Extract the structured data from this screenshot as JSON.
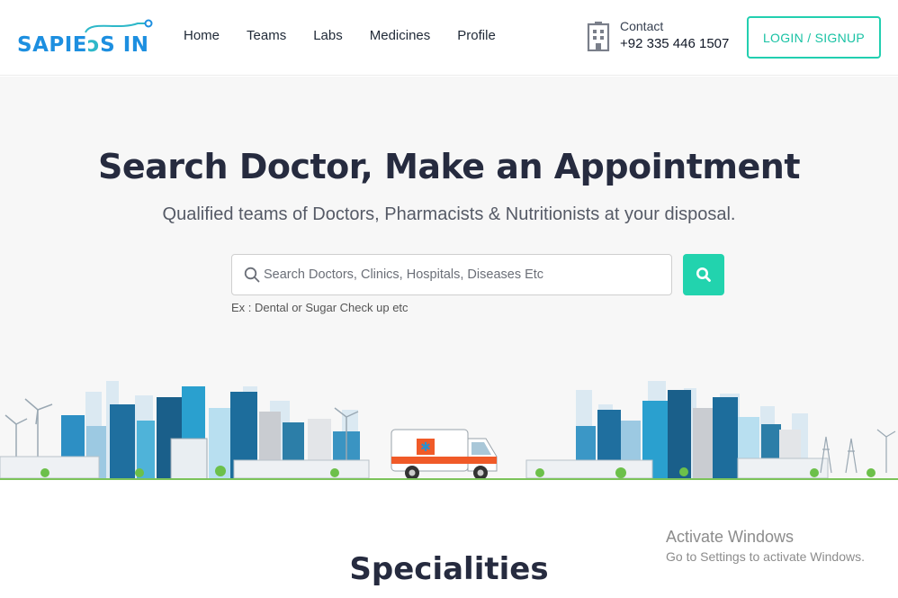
{
  "header": {
    "logo_text_a": "SAPIE",
    "logo_text_b": "S IN",
    "nav": [
      {
        "label": "Home"
      },
      {
        "label": "Teams"
      },
      {
        "label": "Labs"
      },
      {
        "label": "Medicines"
      },
      {
        "label": "Profile"
      }
    ],
    "contact_label": "Contact",
    "contact_phone": "+92 335 446 1507",
    "contact_icon": "building-icon",
    "login_label": "LOGIN / SIGNUP"
  },
  "hero": {
    "title": "Search Doctor, Make an Appointment",
    "subtitle": "Qualified teams of Doctors, Pharmacists & Nutritionists at your disposal.",
    "search_placeholder": "Search Doctors, Clinics, Hospitals, Diseases Etc",
    "search_value": "",
    "search_hint": "Ex : Dental or Sugar Check up etc",
    "illustration": "city-skyline-with-ambulance"
  },
  "section": {
    "specialities_title": "Specialities"
  },
  "watermark": {
    "title": "Activate Windows",
    "subtitle": "Go to Settings to activate Windows."
  },
  "colors": {
    "accent": "#22d3ae",
    "logo_blue": "#1d8fe0",
    "heading": "#262b3f",
    "hero_bg": "#f7f7f7"
  }
}
